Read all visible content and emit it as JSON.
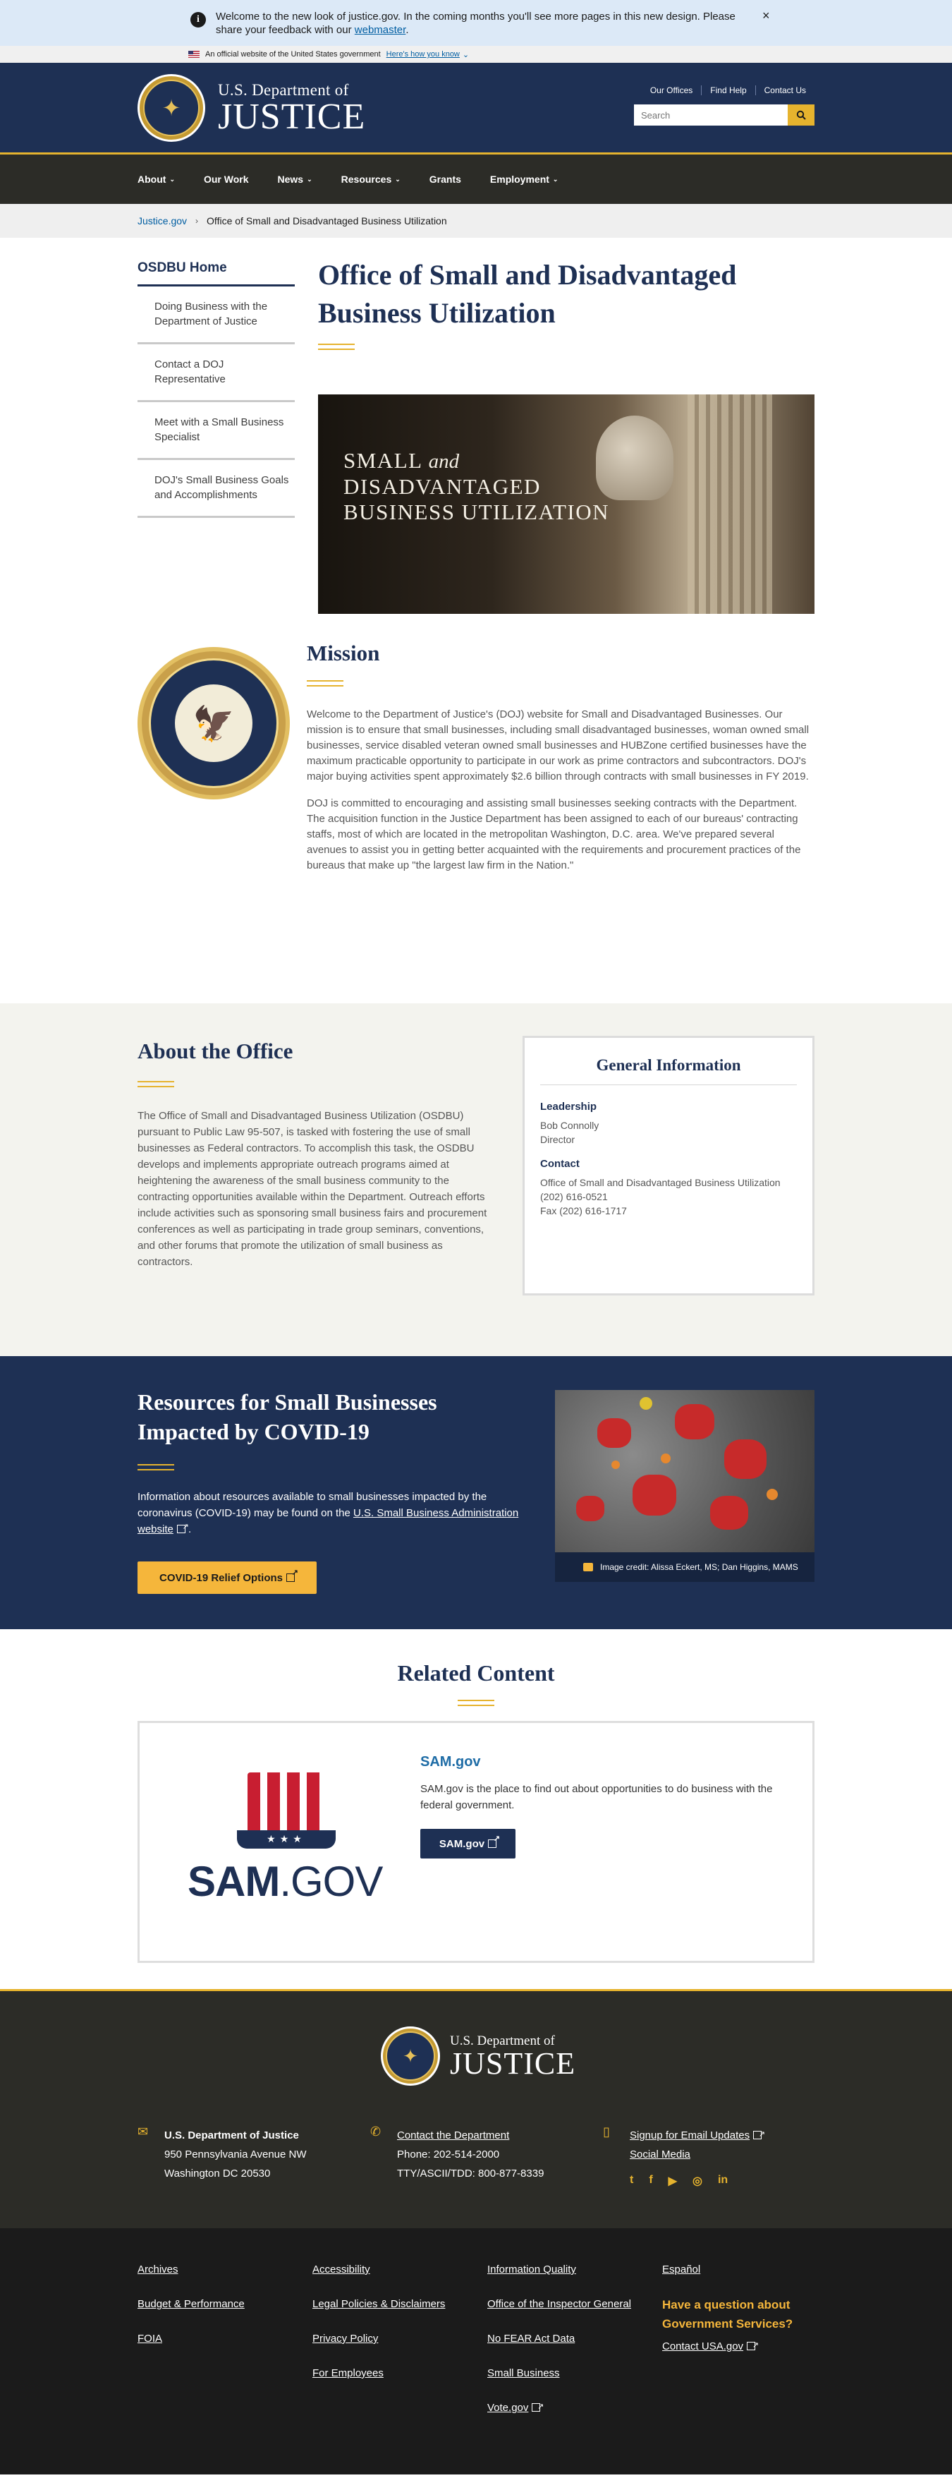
{
  "notice": {
    "message": "Welcome to the new look of justice.gov. In the coming months you'll see more pages in this new design. Please share your feedback with our",
    "link": "webmaster",
    "end": ".",
    "close": "×"
  },
  "gov_banner": {
    "text": "An official website of the United States government",
    "link": "Here's how you know"
  },
  "header": {
    "line1": "U.S. Department of",
    "line2": "JUSTICE",
    "utility_links": [
      "Our Offices",
      "Find Help",
      "Contact Us"
    ],
    "search_placeholder": "Search"
  },
  "nav": {
    "items": [
      {
        "label": "About",
        "caret": "⌄"
      },
      {
        "label": "Our Work",
        "caret": ""
      },
      {
        "label": "News",
        "caret": "⌄"
      },
      {
        "label": "Resources",
        "caret": "⌄"
      },
      {
        "label": "Grants",
        "caret": ""
      },
      {
        "label": "Employment",
        "caret": "⌄"
      }
    ]
  },
  "breadcrumb": {
    "home": "Justice.gov",
    "separator": "›",
    "current": "Office of Small and Disadvantaged Business Utilization"
  },
  "sidenav": {
    "head": "OSDBU Home",
    "links": [
      "Doing Business with the Department of Justice",
      "Contact a DOJ Representative",
      "Meet with a Small Business Specialist",
      "DOJ's Small Business Goals and Accomplishments"
    ]
  },
  "page": {
    "title": "Office of Small and Disadvantaged Business Utilization",
    "hero_line1": "Small",
    "hero_and": "and",
    "hero_line2": "Disadvantaged",
    "hero_line3": "Business Utilization"
  },
  "mission": {
    "heading": "Mission",
    "p1": "Welcome to the Department of Justice's (DOJ) website for Small and Disadvantaged Businesses. Our mission is to ensure that small businesses, including small disadvantaged businesses, woman owned small businesses, service disabled veteran owned small businesses and HUBZone certified businesses have the maximum practicable opportunity to participate in our work as prime contractors and subcontractors. DOJ's major buying activities spent approximately $2.6 billion through contracts with small businesses in FY 2019.",
    "p2": "DOJ is committed to encouraging and assisting small businesses seeking contracts with the Department. The acquisition function in the Justice Department has been assigned to each of our bureaus' contracting staffs, most of which are located in the metropolitan Washington, D.C. area. We've prepared several avenues to assist you in getting better acquainted with the requirements and procurement practices of the bureaus that make up \"the largest law firm in the Nation.\""
  },
  "about": {
    "heading": "About the Office",
    "body": "The Office of Small and Disadvantaged Business Utilization (OSDBU) pursuant to Public Law 95-507, is tasked with fostering the use of small businesses as Federal contractors. To accomplish this task, the OSDBU develops and implements appropriate outreach programs aimed at heightening the awareness of the small business community to the contracting opportunities available within the Department. Outreach efforts include activities such as sponsoring small business fairs and procurement conferences as well as participating in trade group seminars, conventions, and other forums that promote the utilization of small business as contractors.",
    "card": {
      "title": "General Information",
      "leadership_label": "Leadership",
      "leader_name": "Bob Connolly",
      "leader_title": "Director",
      "contact_label": "Contact",
      "office": "Office of Small and Disadvantaged Business Utilization",
      "phone": "(202) 616-0521",
      "fax": "Fax (202) 616-1717"
    }
  },
  "covid": {
    "heading": "Resources for Small Businesses Impacted by COVID-19",
    "body": "Information about resources available to small businesses impacted by the coronavirus (COVID-19) may be found on the",
    "link": "U.S. Small Business Administration website",
    "end": ".",
    "cta": "COVID-19 Relief Options",
    "credit": "Image credit: Alissa Eckert, MS; Dan Higgins, MAMS"
  },
  "related": {
    "heading": "Related Content",
    "card_title": "SAM.gov",
    "card_desc": "SAM.gov is the place to find out about opportunities to do business with the federal government.",
    "card_button": "SAM.gov",
    "logo_sam": "SAM",
    "logo_gov": ".GOV",
    "logo_stars": "★★★"
  },
  "footer": {
    "line1": "U.S. Department of",
    "line2": "JUSTICE",
    "address_title": "U.S. Department of Justice",
    "address1": "950 Pennsylvania Avenue NW",
    "address2": "Washington DC 20530",
    "contact_link": "Contact the Department",
    "phone": "Phone: 202-514-2000",
    "tty": "TTY/ASCII/TDD: 800-877-8339",
    "signup": "Signup for Email Updates",
    "social_media": "Social Media",
    "social_icons": [
      "t",
      "f",
      "▶",
      "◎",
      "in"
    ],
    "links_col1": [
      "Archives",
      "Budget & Performance",
      "FOIA"
    ],
    "links_col2": [
      "Accessibility",
      "Legal Policies & Disclaimers",
      "Privacy Policy",
      "For Employees"
    ],
    "links_col3": [
      "Information Quality",
      "Office of the Inspector General",
      "No FEAR Act Data",
      "Small Business",
      "Vote.gov"
    ],
    "links_col4": [
      "Español"
    ],
    "ask": "Have a question about Government Services?",
    "ask_link": "Contact USA.gov"
  },
  "colors": {
    "navy": "#1e3054",
    "gold": "#e6b32e",
    "link": "#005ea2"
  }
}
